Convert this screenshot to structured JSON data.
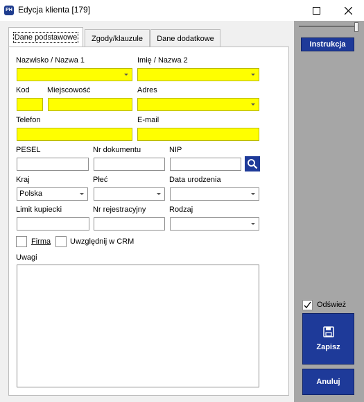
{
  "window": {
    "title": "Edycja klienta [179]",
    "app_icon_text": "PH"
  },
  "tabs": [
    {
      "label": "Dane podstawowe",
      "active": true
    },
    {
      "label": "Zgody/klauzule",
      "active": false
    },
    {
      "label": "Dane dodatkowe",
      "active": false
    }
  ],
  "form": {
    "nazwisko_label": "Nazwisko / Nazwa 1",
    "imie_label": "Imię / Nazwa 2",
    "kod_label": "Kod",
    "miejscowosc_label": "Miejscowość",
    "adres_label": "Adres",
    "telefon_label": "Telefon",
    "email_label": "E-mail",
    "pesel_label": "PESEL",
    "nr_dokumentu_label": "Nr dokumentu",
    "nip_label": "NIP",
    "kraj_label": "Kraj",
    "kraj_value": "Polska",
    "plec_label": "Płeć",
    "data_urodzenia_label": "Data urodzenia",
    "limit_label": "Limit kupiecki",
    "nr_rej_label": "Nr rejestracyjny",
    "rodzaj_label": "Rodzaj",
    "firma_label": "Firma",
    "crm_label": "Uwzględnij w CRM",
    "uwagi_label": "Uwagi"
  },
  "side": {
    "instrukcja_label": "Instrukcja",
    "odswiez_label": "Odśwież",
    "odswiez_checked": true,
    "zapisz_label": "Zapisz",
    "anuluj_label": "Anuluj"
  },
  "colors": {
    "required_field": "#ffff00",
    "button_blue": "#1e3a99",
    "right_panel": "#a6a6a6"
  }
}
